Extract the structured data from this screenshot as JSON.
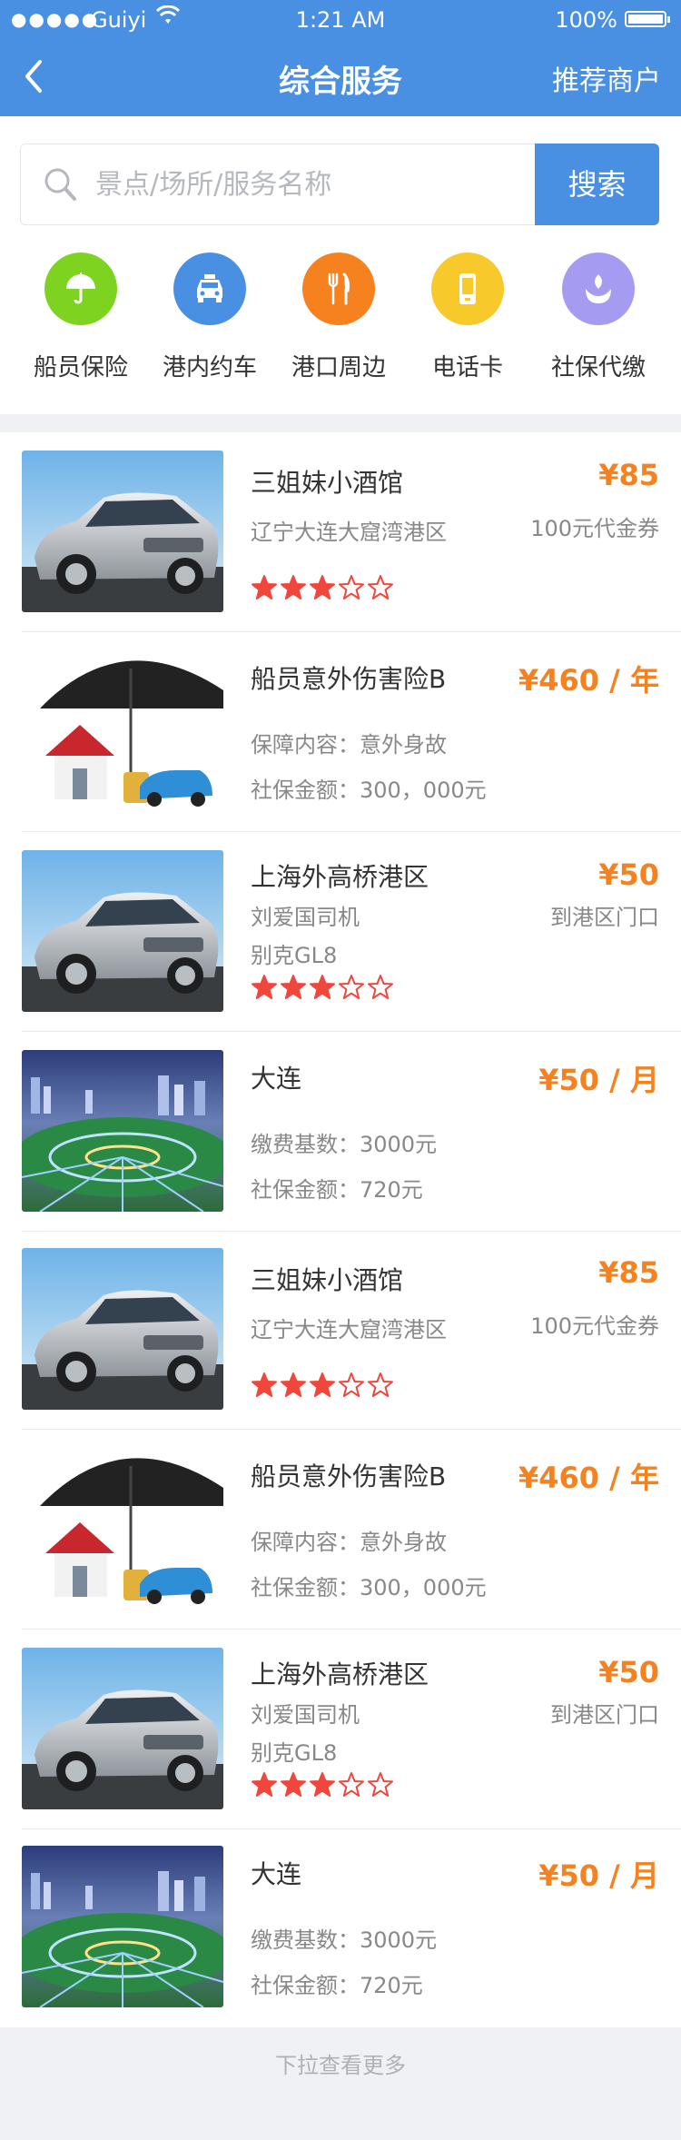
{
  "status_bar": {
    "signal": "●●●●●",
    "carrier": "Guiyi",
    "time": "1:21 AM",
    "battery": "100%"
  },
  "nav": {
    "title": "综合服务",
    "right_label": "推荐商户"
  },
  "search": {
    "placeholder": "景点/场所/服务名称",
    "button": "搜索"
  },
  "categories": [
    {
      "label": "船员保险",
      "icon": "umbrella-icon",
      "color": "#7ed321"
    },
    {
      "label": "港内约车",
      "icon": "taxi-icon",
      "color": "#4a90e2"
    },
    {
      "label": "港口周边",
      "icon": "fork-knife-icon",
      "color": "#f5821f"
    },
    {
      "label": "电话卡",
      "icon": "phone-card-icon",
      "color": "#f8c92a"
    },
    {
      "label": "社保代缴",
      "icon": "social-insurance-icon",
      "color": "#a59cf2"
    }
  ],
  "items": [
    {
      "name": "三姐妹小酒馆",
      "price": "¥85",
      "line1": "辽宁大连大窟湾港区",
      "right": "100元代金券",
      "rating": 3,
      "image": "car"
    },
    {
      "name": "船员意外伤害险B",
      "price": "¥460 / 年",
      "line1": "保障内容：意外身故",
      "line2": "社保金额：300，000元",
      "image": "umbrella-house"
    },
    {
      "name": "上海外高桥港区",
      "price": "¥50",
      "line1": "刘爱国司机",
      "line2": "别克GL8",
      "right": "到港区门口",
      "rating": 3,
      "image": "car"
    },
    {
      "name": "大连",
      "price": "¥50 / 月",
      "line1": "缴费基数：3000元",
      "line2": "社保金额：720元",
      "image": "city"
    },
    {
      "name": "三姐妹小酒馆",
      "price": "¥85",
      "line1": "辽宁大连大窟湾港区",
      "right": "100元代金券",
      "rating": 3,
      "image": "car"
    },
    {
      "name": "船员意外伤害险B",
      "price": "¥460 / 年",
      "line1": "保障内容：意外身故",
      "line2": "社保金额：300，000元",
      "image": "umbrella-house"
    },
    {
      "name": "上海外高桥港区",
      "price": "¥50",
      "line1": "刘爱国司机",
      "line2": "别克GL8",
      "right": "到港区门口",
      "rating": 3,
      "image": "car"
    },
    {
      "name": "大连",
      "price": "¥50 / 月",
      "line1": "缴费基数：3000元",
      "line2": "社保金额：720元",
      "image": "city"
    }
  ],
  "rating_max": 5,
  "load_more": "下拉查看更多",
  "colors": {
    "primary": "#4a90e2",
    "price": "#f5821f",
    "star": "#f0463c"
  }
}
